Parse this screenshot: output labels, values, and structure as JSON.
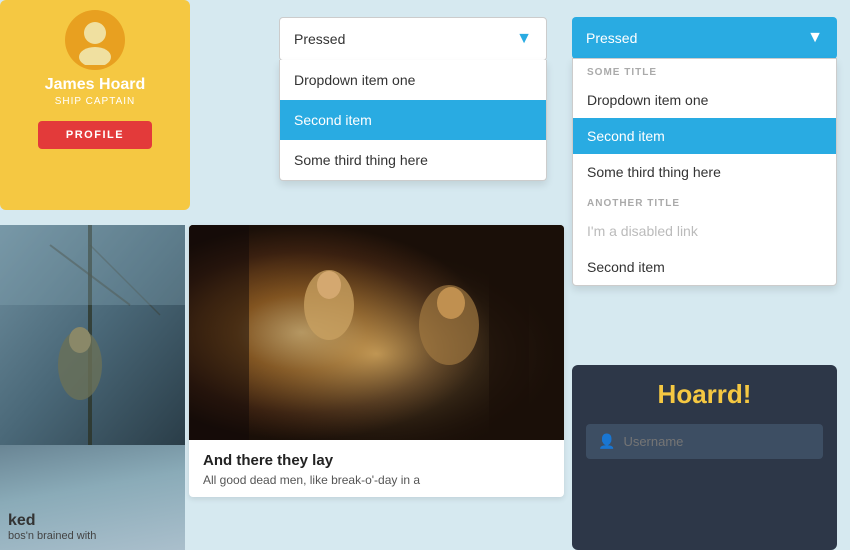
{
  "profile": {
    "name": "James Hoard",
    "title": "SHIP CAPTAIN",
    "btn_label": "PROFILE"
  },
  "dropdown1": {
    "selected": "Pressed",
    "items": [
      {
        "label": "Dropdown item one",
        "selected": false
      },
      {
        "label": "Second item",
        "selected": true
      },
      {
        "label": "Some third thing here",
        "selected": false
      }
    ]
  },
  "dropdown2": {
    "selected": "Pressed",
    "sections": [
      {
        "title": "SOME TITLE",
        "items": [
          {
            "label": "Dropdown item one",
            "selected": false,
            "disabled": false
          },
          {
            "label": "Second item",
            "selected": true,
            "disabled": false
          },
          {
            "label": "Some third thing here",
            "selected": false,
            "disabled": false
          }
        ]
      },
      {
        "title": "ANOTHER TITLE",
        "items": [
          {
            "label": "I'm a disabled link",
            "selected": false,
            "disabled": true
          },
          {
            "label": "Second item",
            "selected": false,
            "disabled": false
          }
        ]
      }
    ]
  },
  "card2": {
    "title": "And there they lay",
    "body": "All good dead men, like break-o'-day in a"
  },
  "leftcard": {
    "title": "ked",
    "body": "bos'n brained with"
  },
  "login": {
    "title": "Hoarrd!",
    "username_placeholder": "Username"
  },
  "colors": {
    "accent": "#29abe2",
    "yellow": "#f5c842",
    "red": "#e33a3a",
    "dark": "#2d3748"
  }
}
